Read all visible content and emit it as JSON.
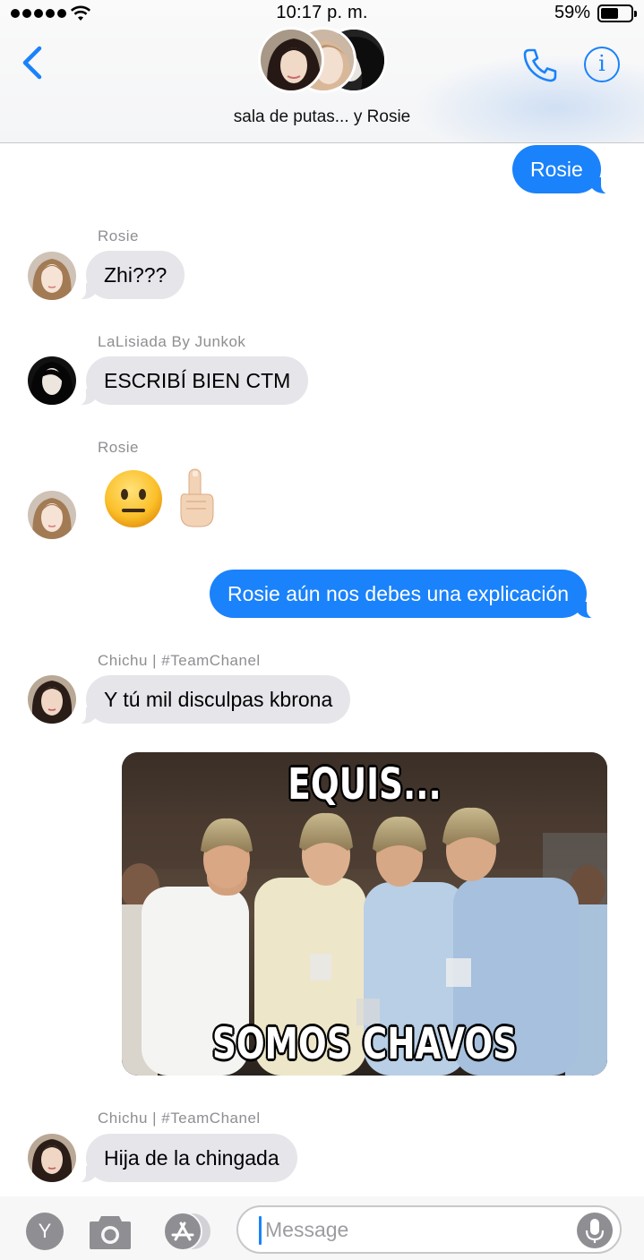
{
  "status_bar": {
    "time": "10:17 p. m.",
    "battery_percent": "59%"
  },
  "header": {
    "group_title": "sala de putas... y  Rosie",
    "info_glyph": "i",
    "icons": {
      "back": "chevron-left-icon",
      "call": "phone-icon",
      "info": "info-icon"
    }
  },
  "messages": [
    {
      "type": "outgoing",
      "text": "Rosie"
    },
    {
      "type": "incoming",
      "sender": "Rosie",
      "text": "Zhi???"
    },
    {
      "type": "incoming",
      "sender": "LaLisiada By Junkok",
      "text": "ESCRIBÍ BIEN CTM"
    },
    {
      "type": "incoming-emoji",
      "sender": "Rosie",
      "emojis": [
        "neutral-face-emoji",
        "middle-finger-emoji"
      ]
    },
    {
      "type": "outgoing",
      "text": "Rosie aún nos debes una explicación"
    },
    {
      "type": "incoming",
      "sender": "Chichu | #TeamChanel",
      "text": "Y tú mil disculpas kbrona"
    },
    {
      "type": "image",
      "meme_top_text": "EQUIS...",
      "meme_bottom_text": "SOMOS CHAVOS"
    },
    {
      "type": "incoming",
      "sender": "Chichu | #TeamChanel",
      "text": "Hija de la chingada"
    }
  ],
  "input_bar": {
    "app_label": "Y",
    "placeholder": "Message",
    "icons": [
      "app-y-icon",
      "camera-icon",
      "app-store-icon",
      "microphone-icon"
    ]
  },
  "colors": {
    "accent": "#1a82fb",
    "incoming_bubble": "#e5e5ea",
    "outgoing_bubble": "#1a82fb",
    "sender_gray": "#8e8e93"
  }
}
